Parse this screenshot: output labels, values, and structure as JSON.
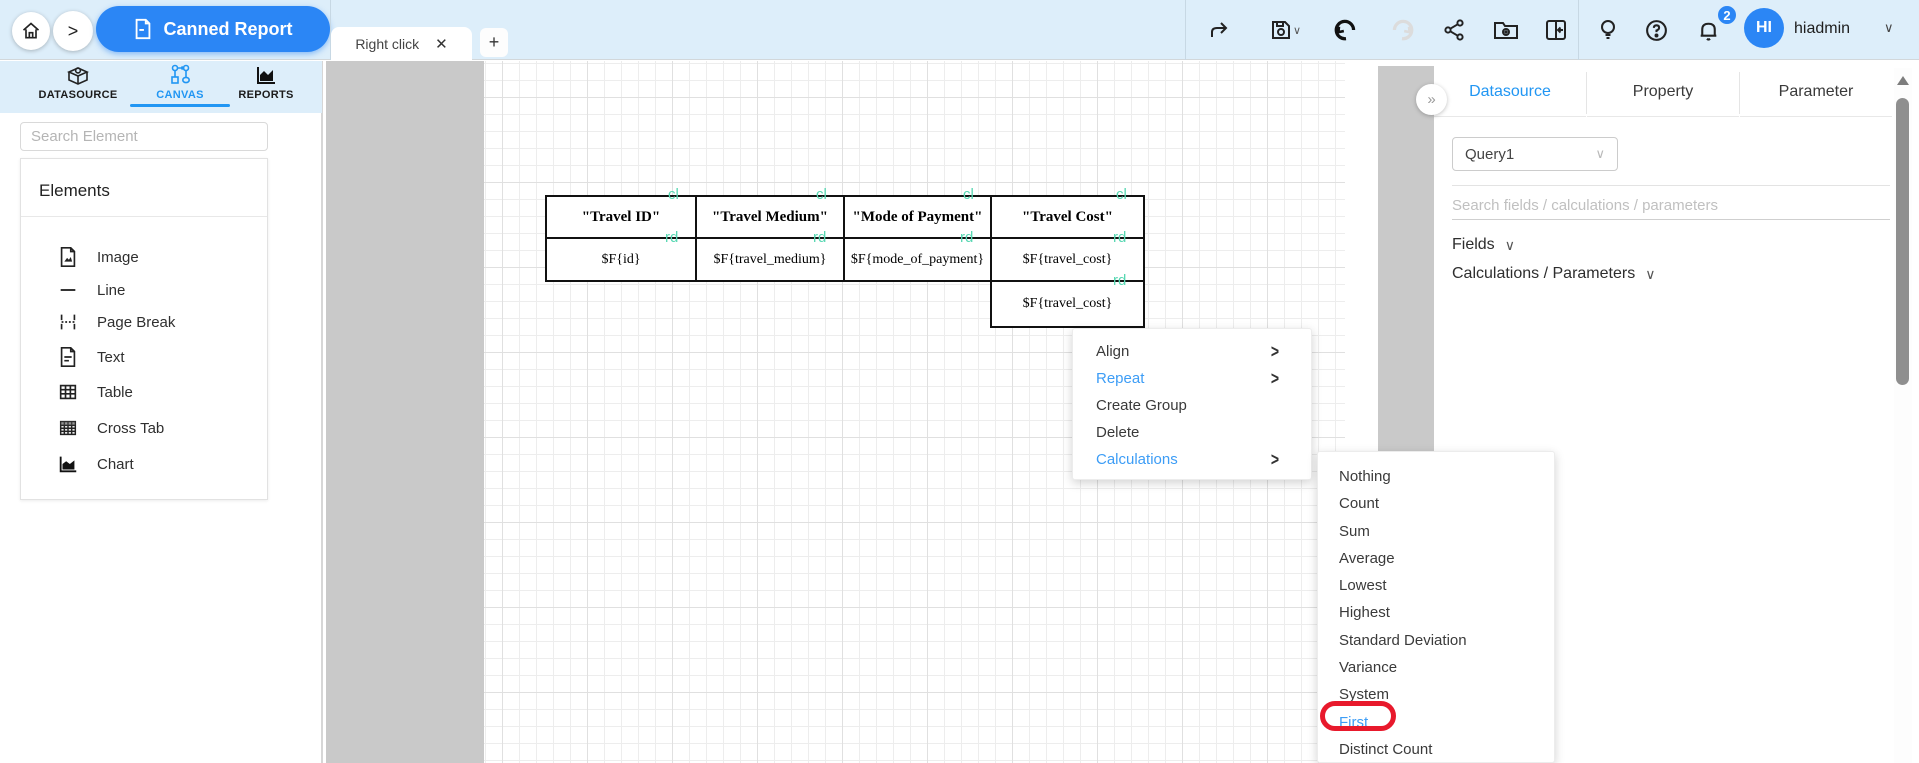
{
  "topbar": {
    "title": "Canned Report",
    "notification_count": "2",
    "user": {
      "initials": "HI",
      "name": "hiadmin",
      "caret": "∨"
    }
  },
  "tabbar": {
    "active_tab": "Right click",
    "close_glyph": "✕",
    "new_tab_glyph": "+"
  },
  "sidebar": {
    "tabs": [
      {
        "label": "DATASOURCE"
      },
      {
        "label": "CANVAS"
      },
      {
        "label": "REPORTS"
      }
    ],
    "search_placeholder": "Search Element",
    "elements_title": "Elements",
    "elements": [
      {
        "label": "Image"
      },
      {
        "label": "Line"
      },
      {
        "label": "Page Break"
      },
      {
        "label": "Text"
      },
      {
        "label": "Table"
      },
      {
        "label": "Cross Tab"
      },
      {
        "label": "Chart"
      }
    ]
  },
  "canvas": {
    "table": {
      "headers": [
        "\"Travel ID\"",
        "\"Travel Medium\"",
        "\"Mode of Payment\"",
        "\"Travel Cost\""
      ],
      "fields": [
        "$F{id}",
        "$F{travel_medium}",
        "$F{mode_of_payment}",
        "$F{travel_cost}"
      ],
      "extra_cell": "$F{travel_cost}",
      "header_tag": "cl",
      "row_tag": "rd"
    }
  },
  "context_menu": {
    "items": [
      {
        "label": "Align"
      },
      {
        "label": "Repeat"
      },
      {
        "label": "Create Group"
      },
      {
        "label": "Delete"
      },
      {
        "label": "Calculations"
      }
    ],
    "submenu_glyph": ">"
  },
  "calc_submenu": {
    "items": [
      {
        "label": "Nothing"
      },
      {
        "label": "Count"
      },
      {
        "label": "Sum"
      },
      {
        "label": "Average"
      },
      {
        "label": "Lowest"
      },
      {
        "label": "Highest"
      },
      {
        "label": "Standard Deviation"
      },
      {
        "label": "Variance"
      },
      {
        "label": "System"
      },
      {
        "label": "First"
      },
      {
        "label": "Distinct Count"
      }
    ],
    "annotated_item": "First"
  },
  "right_panel": {
    "tabs": [
      {
        "label": "Datasource"
      },
      {
        "label": "Property"
      },
      {
        "label": "Parameter"
      }
    ],
    "collapse_glyph": "»",
    "query_select_value": "Query1",
    "search_placeholder": "Search fields / calculations / parameters",
    "sections": [
      {
        "label": "Fields"
      },
      {
        "label": "Calculations / Parameters"
      }
    ]
  },
  "colors": {
    "accent": "#2b86f5",
    "tag_teal": "#57d7b2",
    "annotation_red": "#e8192c"
  }
}
